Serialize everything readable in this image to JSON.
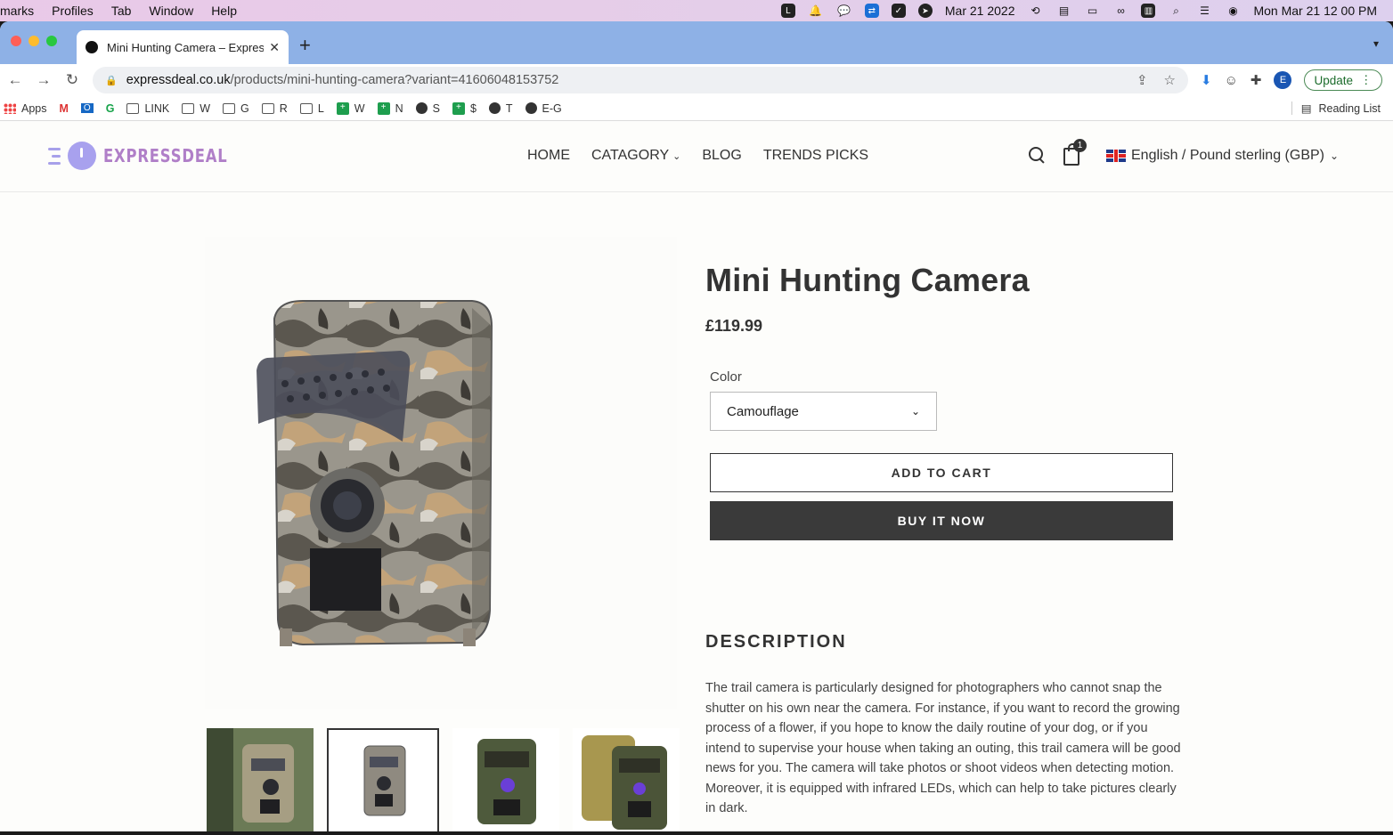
{
  "os_menubar": {
    "items": [
      "marks",
      "Profiles",
      "Tab",
      "Window",
      "Help"
    ],
    "date_short": "Mar 21 2022",
    "datetime": "Mon Mar 21  12 00 PM"
  },
  "browser": {
    "tab_title": "Mini Hunting Camera – ExpressDeal",
    "url_host": "expressdeal.co.uk",
    "url_path": "/products/mini-hunting-camera?variant=41606048153752",
    "profile_initial": "E",
    "update_label": "Update",
    "bookmarks": [
      "Apps",
      "LINK",
      "W",
      "G",
      "R",
      "L",
      "W",
      "N",
      "S",
      "$",
      "T",
      "E-G"
    ],
    "reading_list": "Reading List"
  },
  "site": {
    "logo_text": "EXPRESSDEAL",
    "nav": [
      "HOME",
      "CATAGORY",
      "BLOG",
      "TRENDS PICKS"
    ],
    "cart_count": "1",
    "locale": "English / Pound sterling (GBP)"
  },
  "product": {
    "title": "Mini Hunting Camera",
    "price": "£119.99",
    "option_label": "Color",
    "option_value": "Camouflage",
    "add_to_cart": "ADD TO CART",
    "buy_now": "BUY IT NOW",
    "description_heading": "DESCRIPTION",
    "description": "The trail camera is particularly designed for photographers who cannot snap the shutter on his own near the camera. For instance, if you want to record the growing process of a flower, if you hope to know the daily routine of your dog, or if you intend to supervise your house when taking an outing, this trail camera will be good news for you. The camera will take photos or shoot videos when detecting motion. Moreover, it is equipped with infrared LEDs, which can help to take pictures clearly in dark."
  },
  "colors": {
    "accent_logo": "#b07fc8",
    "button_dark": "#3a3a3a",
    "tabbar": "#8eb1e6"
  }
}
